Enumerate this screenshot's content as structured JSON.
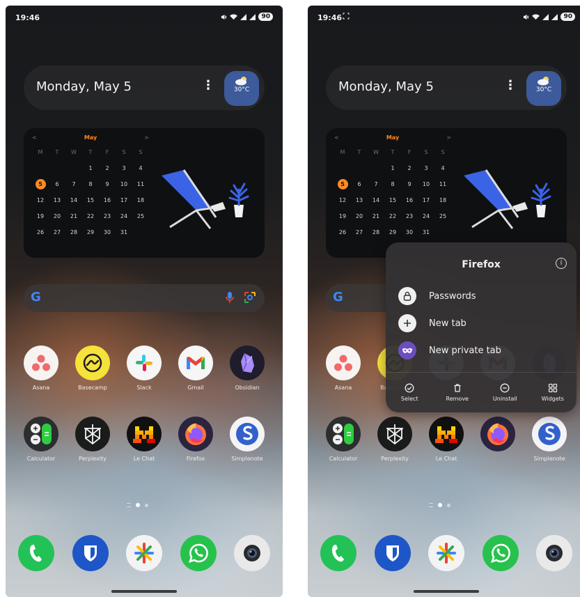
{
  "colors": {
    "accent_orange": "#ff8a24",
    "weather_blue": "#3d5a9a",
    "menu_background": "#343234"
  },
  "screens": [
    {
      "id": "left",
      "status_bar": {
        "time": "19:46",
        "extra_icon": "",
        "battery": "90",
        "icons": [
          "mute-icon",
          "wifi-icon",
          "signal-icon",
          "signal-icon"
        ]
      },
      "date_widget": {
        "date": "Monday, May 5",
        "menu_glyph": "⋮",
        "temperature": "30°C"
      },
      "calendar": {
        "prev": "<",
        "month": "May",
        "next": ">",
        "weekdays": [
          "M",
          "T",
          "W",
          "T",
          "F",
          "S",
          "S"
        ],
        "days": [
          "",
          "",
          "",
          "1",
          "2",
          "3",
          "4",
          "5",
          "6",
          "7",
          "8",
          "9",
          "10",
          "11",
          "12",
          "13",
          "14",
          "15",
          "16",
          "17",
          "18",
          "19",
          "20",
          "21",
          "22",
          "23",
          "24",
          "25",
          "26",
          "27",
          "28",
          "29",
          "30",
          "31",
          ""
        ],
        "today": "5"
      },
      "search": {
        "logo": "G"
      },
      "apps": [
        {
          "label": "Asana",
          "icon": "asana-icon"
        },
        {
          "label": "Basecamp",
          "icon": "basecamp-icon"
        },
        {
          "label": "Slack",
          "icon": "slack-icon"
        },
        {
          "label": "Gmail",
          "icon": "gmail-icon"
        },
        {
          "label": "Obsidian",
          "icon": "obsidian-icon"
        },
        {
          "label": "Calculator",
          "icon": "calculator-icon"
        },
        {
          "label": "Perplexity",
          "icon": "perplexity-icon"
        },
        {
          "label": "Le Chat",
          "icon": "lechat-icon"
        },
        {
          "label": "Firefox",
          "icon": "firefox-icon"
        },
        {
          "label": "Simplenote",
          "icon": "simplenote-icon"
        }
      ],
      "dock": [
        "phone-icon",
        "bitwarden-icon",
        "photos-icon",
        "whatsapp-icon",
        "camera-icon"
      ]
    },
    {
      "id": "right",
      "status_bar": {
        "time": "19:46",
        "extra_icon": "[⁠×⁠]",
        "battery": "90",
        "icons": [
          "mute-icon",
          "wifi-icon",
          "signal-icon",
          "signal-icon"
        ]
      },
      "date_widget": {
        "date": "Monday, May 5",
        "menu_glyph": "⋮",
        "temperature": "30°C"
      },
      "calendar": {
        "prev": "<",
        "month": "May",
        "next": ">",
        "weekdays": [
          "M",
          "T",
          "W",
          "T",
          "F",
          "S",
          "S"
        ],
        "days": [
          "",
          "",
          "",
          "1",
          "2",
          "3",
          "4",
          "5",
          "6",
          "7",
          "8",
          "9",
          "10",
          "11",
          "12",
          "13",
          "14",
          "15",
          "16",
          "17",
          "18",
          "19",
          "20",
          "21",
          "22",
          "23",
          "24",
          "25",
          "26",
          "27",
          "28",
          "29",
          "30",
          "31",
          ""
        ],
        "today": "5"
      },
      "search": {
        "logo": "G"
      },
      "apps": [
        {
          "label": "Asana",
          "icon": "asana-icon"
        },
        {
          "label": "Basecamp",
          "icon": "basecamp-icon"
        },
        {
          "label": "",
          "icon": "slack-icon"
        },
        {
          "label": "",
          "icon": "gmail-icon"
        },
        {
          "label": "",
          "icon": "obsidian-icon"
        },
        {
          "label": "Calculator",
          "icon": "calculator-icon"
        },
        {
          "label": "Perplexity",
          "icon": "perplexity-icon"
        },
        {
          "label": "Le Chat",
          "icon": "lechat-icon"
        },
        {
          "label": "",
          "icon": "firefox-icon"
        },
        {
          "label": "Simplenote",
          "icon": "simplenote-icon"
        }
      ],
      "dock": [
        "phone-icon",
        "bitwarden-icon",
        "photos-icon",
        "whatsapp-icon",
        "camera-icon"
      ],
      "context_menu": {
        "title": "Firefox",
        "info_glyph": "i",
        "items": [
          {
            "label": "Passwords",
            "icon": "lock-icon"
          },
          {
            "label": "New tab",
            "icon": "plus-icon"
          },
          {
            "label": "New private tab",
            "icon": "mask-icon"
          }
        ],
        "actions": [
          {
            "label": "Select",
            "icon": "check-circle-icon"
          },
          {
            "label": "Remove",
            "icon": "trash-icon"
          },
          {
            "label": "Uninstall",
            "icon": "minus-circle-icon"
          },
          {
            "label": "Widgets",
            "icon": "widgets-icon"
          }
        ]
      }
    }
  ]
}
